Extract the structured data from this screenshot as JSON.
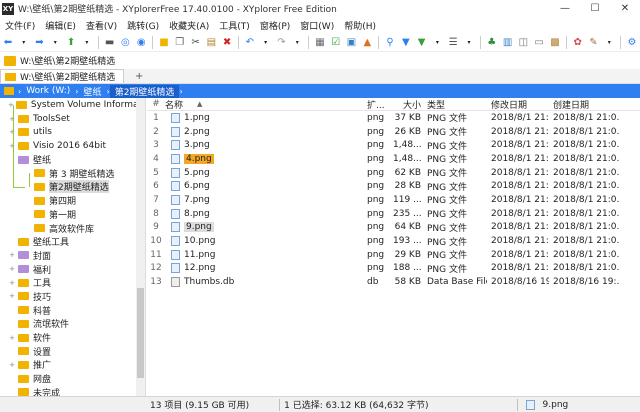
{
  "window": {
    "title": "W:\\壁纸\\第2期壁纸精选 - XYplorerFree 17.40.0100 - XYplorer Free Edition",
    "app_icon": "XY"
  },
  "menu": [
    "文件(F)",
    "编辑(E)",
    "查看(V)",
    "跳转(G)",
    "收藏夹(A)",
    "工具(T)",
    "窗格(P)",
    "窗口(W)",
    "帮助(H)"
  ],
  "toolbar_icons": [
    "back-icon",
    "back-dropdown-icon",
    "forward-icon",
    "forward-dropdown-icon",
    "up-icon",
    "up-dropdown-icon",
    "monitor-icon",
    "target-icon",
    "search-globe-icon",
    "new-folder-icon",
    "copy-icon",
    "cut-icon",
    "paste-icon",
    "delete-icon",
    "undo-icon",
    "undo-dropdown-icon",
    "redo-icon",
    "redo-dropdown-icon",
    "properties-icon",
    "checkbox-icon",
    "image-icon",
    "paint-icon",
    "search-icon",
    "filter-icon",
    "filter-dropdown-icon",
    "view-icon",
    "view-dropdown-icon",
    "tree-icon",
    "layout-icon",
    "panes-icon",
    "preview-icon",
    "info-icon",
    "tools-icon",
    "brush-icon",
    "brush-dropdown-icon",
    "settings-icon"
  ],
  "address": {
    "path": "W:\\壁纸\\第2期壁纸精选"
  },
  "tab": {
    "label": "W:\\壁纸\\第2期壁纸精选",
    "new_tab": "+"
  },
  "breadcrumb": [
    "Work (W:)",
    "壁纸",
    "第2期壁纸精选"
  ],
  "tree": [
    {
      "label": "System Volume Information",
      "indent": 1,
      "expander": "+",
      "icon": "folder"
    },
    {
      "label": "ToolsSet",
      "indent": 1,
      "expander": "+",
      "icon": "folder"
    },
    {
      "label": "utils",
      "indent": 1,
      "expander": "+",
      "icon": "folder"
    },
    {
      "label": "Visio 2016 64bit",
      "indent": 1,
      "expander": "+",
      "icon": "folder"
    },
    {
      "label": "壁纸",
      "indent": 1,
      "expander": "",
      "icon": "folder-purple"
    },
    {
      "label": "第 3 期壁纸精选",
      "indent": 2,
      "expander": "",
      "icon": "folder"
    },
    {
      "label": "第2期壁纸精选",
      "indent": 2,
      "expander": "",
      "icon": "folder",
      "selected": true
    },
    {
      "label": "第四期",
      "indent": 2,
      "expander": "",
      "icon": "folder"
    },
    {
      "label": "第一期",
      "indent": 2,
      "expander": "",
      "icon": "folder"
    },
    {
      "label": "高效软件库",
      "indent": 2,
      "expander": "",
      "icon": "folder"
    },
    {
      "label": "壁纸工具",
      "indent": 1,
      "expander": "",
      "icon": "folder"
    },
    {
      "label": "封面",
      "indent": 1,
      "expander": "+",
      "icon": "folder-purple"
    },
    {
      "label": "福利",
      "indent": 1,
      "expander": "+",
      "icon": "folder-purple"
    },
    {
      "label": "工具",
      "indent": 1,
      "expander": "+",
      "icon": "folder"
    },
    {
      "label": "技巧",
      "indent": 1,
      "expander": "+",
      "icon": "folder"
    },
    {
      "label": "科普",
      "indent": 1,
      "expander": "",
      "icon": "folder"
    },
    {
      "label": "流氓软件",
      "indent": 1,
      "expander": "",
      "icon": "folder"
    },
    {
      "label": "软件",
      "indent": 1,
      "expander": "+",
      "icon": "folder"
    },
    {
      "label": "设置",
      "indent": 1,
      "expander": "",
      "icon": "folder"
    },
    {
      "label": "推广",
      "indent": 1,
      "expander": "+",
      "icon": "folder"
    },
    {
      "label": "网盘",
      "indent": 1,
      "expander": "",
      "icon": "folder"
    },
    {
      "label": "未完成",
      "indent": 1,
      "expander": "",
      "icon": "folder"
    }
  ],
  "list": {
    "columns": {
      "num": "#",
      "name": "名称",
      "ext": "扩...",
      "size": "大小",
      "type": "类型",
      "modified": "修改日期",
      "created": "创建日期"
    },
    "rows": [
      {
        "num": "1",
        "name": "1.png",
        "ext": "png",
        "size": "37 KB",
        "type": "PNG 文件",
        "modified": "2018/8/1 21:0...",
        "created": "2018/8/1 21:0..."
      },
      {
        "num": "2",
        "name": "2.png",
        "ext": "png",
        "size": "26 KB",
        "type": "PNG 文件",
        "modified": "2018/8/1 21:0...",
        "created": "2018/8/1 21:0..."
      },
      {
        "num": "3",
        "name": "3.png",
        "ext": "png",
        "size": "1,48...",
        "type": "PNG 文件",
        "modified": "2018/8/1 21:0...",
        "created": "2018/8/1 21:0..."
      },
      {
        "num": "4",
        "name": "4.png",
        "ext": "png",
        "size": "1,48...",
        "type": "PNG 文件",
        "modified": "2018/8/1 21:0...",
        "created": "2018/8/1 21:0...",
        "highlight": "orange"
      },
      {
        "num": "5",
        "name": "5.png",
        "ext": "png",
        "size": "62 KB",
        "type": "PNG 文件",
        "modified": "2018/8/1 21:0...",
        "created": "2018/8/1 21:0..."
      },
      {
        "num": "6",
        "name": "6.png",
        "ext": "png",
        "size": "28 KB",
        "type": "PNG 文件",
        "modified": "2018/8/1 21:0...",
        "created": "2018/8/1 21:0..."
      },
      {
        "num": "7",
        "name": "7.png",
        "ext": "png",
        "size": "119 ...",
        "type": "PNG 文件",
        "modified": "2018/8/1 21:0...",
        "created": "2018/8/1 21:0..."
      },
      {
        "num": "8",
        "name": "8.png",
        "ext": "png",
        "size": "235 ...",
        "type": "PNG 文件",
        "modified": "2018/8/1 21:0...",
        "created": "2018/8/1 21:0..."
      },
      {
        "num": "9",
        "name": "9.png",
        "ext": "png",
        "size": "64 KB",
        "type": "PNG 文件",
        "modified": "2018/8/1 21:0...",
        "created": "2018/8/1 21:0...",
        "highlight": "gray"
      },
      {
        "num": "10",
        "name": "10.png",
        "ext": "png",
        "size": "193 ...",
        "type": "PNG 文件",
        "modified": "2018/8/1 21:0...",
        "created": "2018/8/1 21:0..."
      },
      {
        "num": "11",
        "name": "11.png",
        "ext": "png",
        "size": "29 KB",
        "type": "PNG 文件",
        "modified": "2018/8/1 21:0...",
        "created": "2018/8/1 21:0..."
      },
      {
        "num": "12",
        "name": "12.png",
        "ext": "png",
        "size": "188 ...",
        "type": "PNG 文件",
        "modified": "2018/8/1 21:0...",
        "created": "2018/8/1 21:0..."
      },
      {
        "num": "13",
        "name": "Thumbs.db",
        "ext": "db",
        "size": "58 KB",
        "type": "Data Base File",
        "modified": "2018/8/16 19:...",
        "created": "2018/8/16 19:..."
      }
    ]
  },
  "status": {
    "items": "13 项目 (9.15 GB 可用)",
    "selection": "1 已选择: 63.12 KB (64,632 字节)",
    "current_file": "9.png"
  },
  "colors": {
    "accent": "#2f7ff0",
    "folder": "#f0b400",
    "highlight_orange": "#f5a623",
    "tree_line": "#8ccf3a"
  }
}
